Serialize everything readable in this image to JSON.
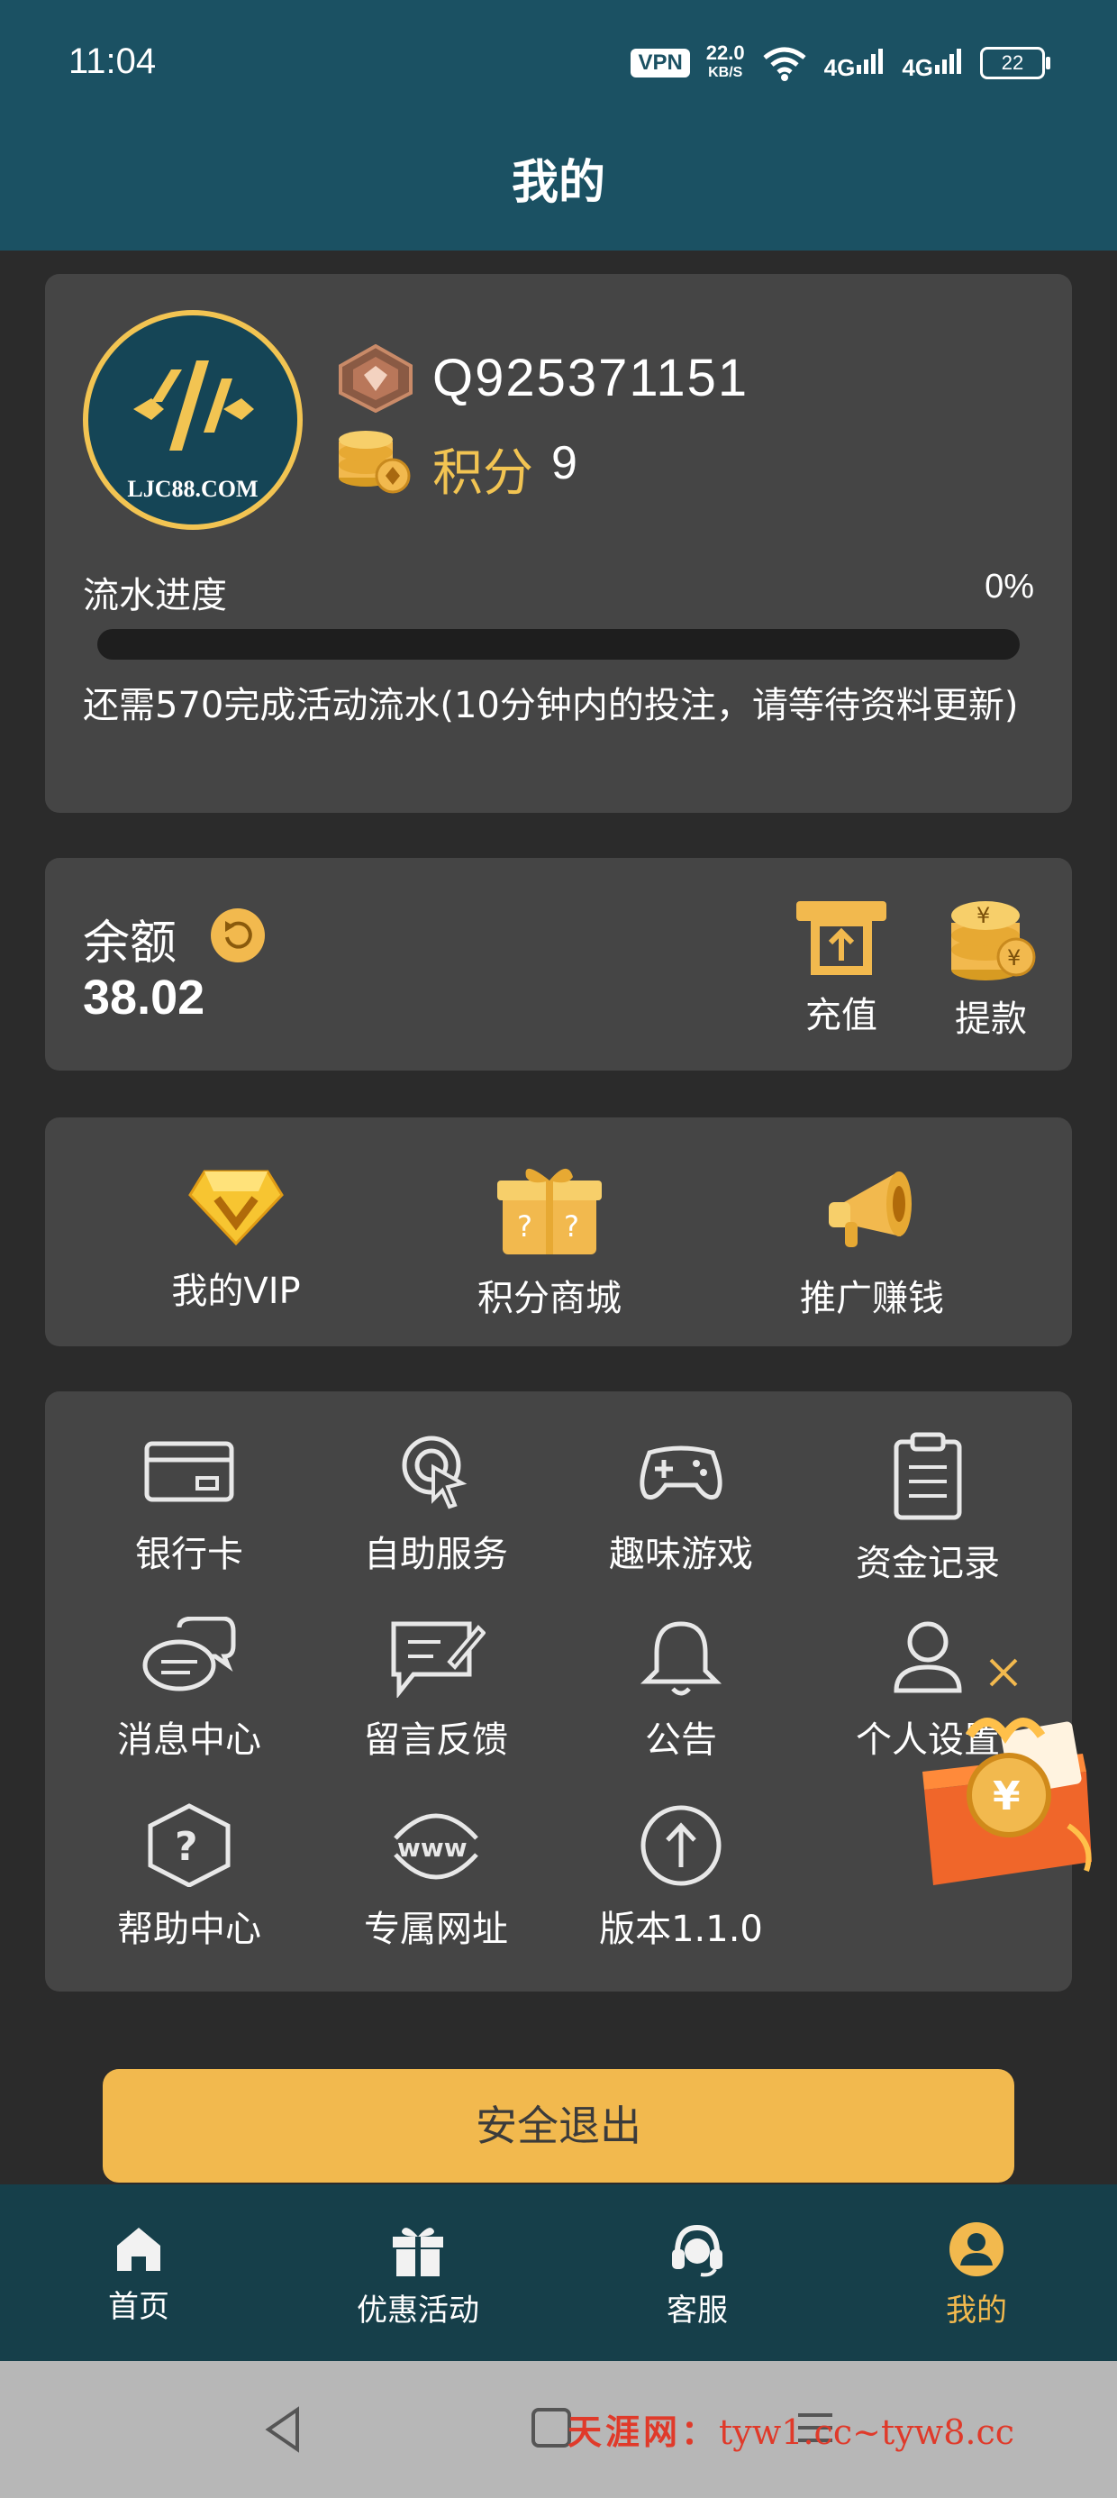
{
  "status_bar": {
    "time": "11:04",
    "vpn": "VPN",
    "net_speed": "22.0",
    "net_unit": "KB/S",
    "signal_1": "4G",
    "signal_2": "4G",
    "battery": "22"
  },
  "header": {
    "title": "我的"
  },
  "profile": {
    "avatar_text": "LJC88.COM",
    "username": "Q925371151",
    "points_label": "积分",
    "points_value": "9",
    "flow_label": "流水进度",
    "flow_percent_text": "0%",
    "flow_progress": 0,
    "flow_note": "还需570完成活动流水(10分钟内的投注，请等待资料更新)"
  },
  "balance": {
    "label": "余额",
    "value": "38.02",
    "deposit_label": "充值",
    "withdraw_label": "提款"
  },
  "features": [
    {
      "label": "我的VIP",
      "icon": "diamond-icon"
    },
    {
      "label": "积分商城",
      "icon": "gift-box-icon"
    },
    {
      "label": "推广赚钱",
      "icon": "megaphone-icon"
    }
  ],
  "grid": [
    {
      "label": "银行卡",
      "icon": "bank-card-icon"
    },
    {
      "label": "自助服务",
      "icon": "self-service-icon"
    },
    {
      "label": "趣味游戏",
      "icon": "gamepad-icon"
    },
    {
      "label": "资金记录",
      "icon": "clipboard-icon"
    },
    {
      "label": "消息中心",
      "icon": "chat-icon"
    },
    {
      "label": "留言反馈",
      "icon": "feedback-icon"
    },
    {
      "label": "公告",
      "icon": "bell-icon"
    },
    {
      "label": "个人设置",
      "icon": "user-icon"
    },
    {
      "label": "帮助中心",
      "icon": "help-icon"
    },
    {
      "label": "专属网址",
      "icon": "www-icon"
    },
    {
      "label": "版本1.1.0",
      "icon": "upgrade-icon"
    }
  ],
  "logout_label": "安全退出",
  "bottom_nav": [
    {
      "label": "首页",
      "icon": "home-icon",
      "active": false
    },
    {
      "label": "优惠活动",
      "icon": "gift-icon",
      "active": false
    },
    {
      "label": "客服",
      "icon": "headset-icon",
      "active": false
    },
    {
      "label": "我的",
      "icon": "profile-icon",
      "active": true
    }
  ],
  "watermark": {
    "site": "天涯网：",
    "url": "tyw1.cc~tyw8.cc"
  },
  "colors": {
    "header_bg": "#1b5163",
    "card_bg": "#454545",
    "accent": "#f2c452",
    "nav_bg": "#163f4a",
    "logout_bg": "#f2b94e"
  }
}
